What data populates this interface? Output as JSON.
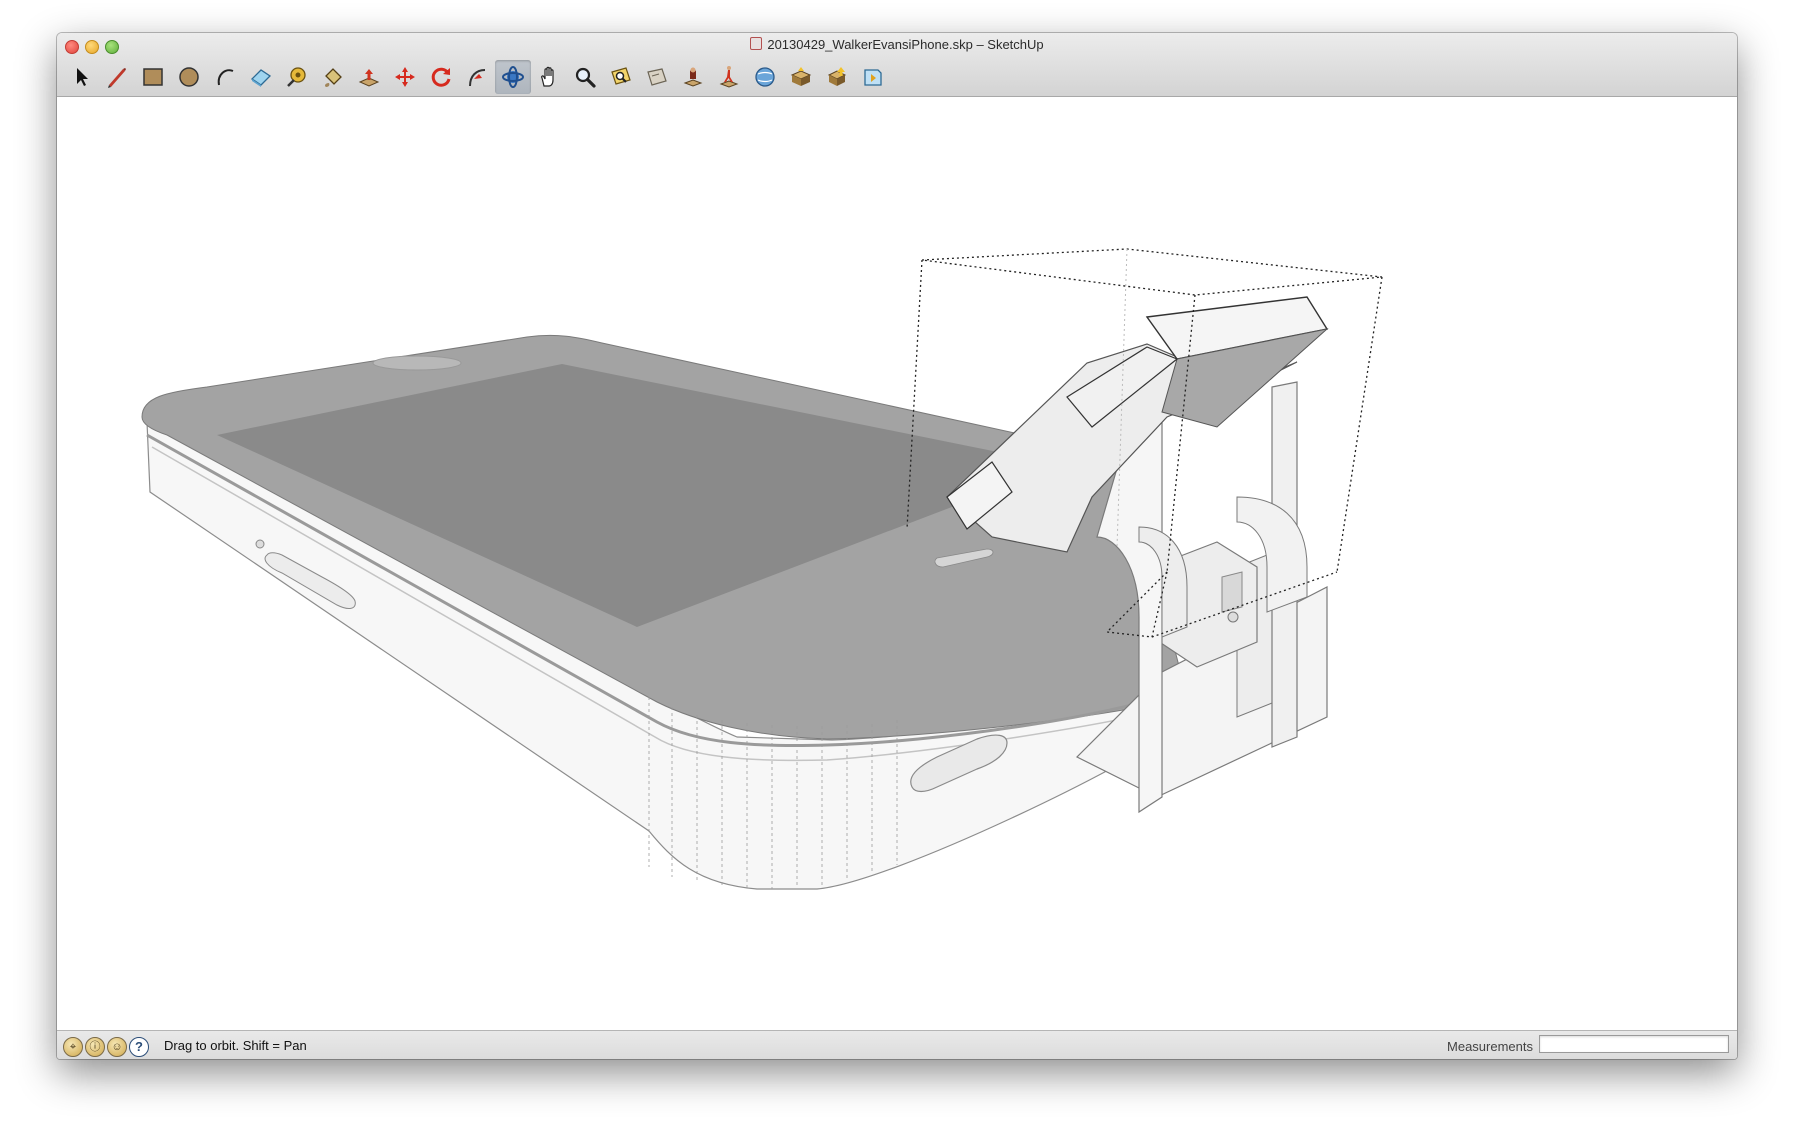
{
  "window": {
    "title": "20130429_WalkerEvansiPhone.skp – SketchUp"
  },
  "toolbar": {
    "active_tool": "orbit",
    "tools": [
      {
        "id": "select",
        "icon": "select-arrow-icon"
      },
      {
        "id": "pencil",
        "icon": "pencil-icon"
      },
      {
        "id": "rectangle",
        "icon": "rectangle-icon"
      },
      {
        "id": "circle",
        "icon": "circle-icon"
      },
      {
        "id": "arc",
        "icon": "arc-icon"
      },
      {
        "id": "eraser",
        "icon": "eraser-icon"
      },
      {
        "id": "tape-measure",
        "icon": "tape-measure-icon"
      },
      {
        "id": "paint-bucket",
        "icon": "paint-bucket-icon"
      },
      {
        "id": "push-pull",
        "icon": "push-pull-icon"
      },
      {
        "id": "move",
        "icon": "move-icon"
      },
      {
        "id": "rotate",
        "icon": "rotate-icon"
      },
      {
        "id": "follow-me",
        "icon": "follow-me-icon"
      },
      {
        "id": "orbit",
        "icon": "orbit-icon"
      },
      {
        "id": "pan",
        "icon": "pan-hand-icon"
      },
      {
        "id": "zoom",
        "icon": "zoom-icon"
      },
      {
        "id": "zoom-extents",
        "icon": "zoom-extents-icon"
      },
      {
        "id": "previous",
        "icon": "previous-view-icon"
      },
      {
        "id": "position-camera",
        "icon": "position-camera-icon"
      },
      {
        "id": "walk",
        "icon": "walk-icon"
      },
      {
        "id": "get-models",
        "icon": "get-models-icon"
      },
      {
        "id": "share-model",
        "icon": "share-model-icon"
      },
      {
        "id": "share-component",
        "icon": "share-component-icon"
      },
      {
        "id": "extension-warehouse",
        "icon": "extension-warehouse-icon"
      }
    ]
  },
  "status": {
    "icons": [
      "geo-location-icon",
      "credits-icon",
      "sign-in-icon",
      "help-icon"
    ],
    "help_glyph": "?",
    "hint": "Drag to orbit.  Shift = Pan",
    "measurements_label": "Measurements",
    "measurements_value": ""
  }
}
